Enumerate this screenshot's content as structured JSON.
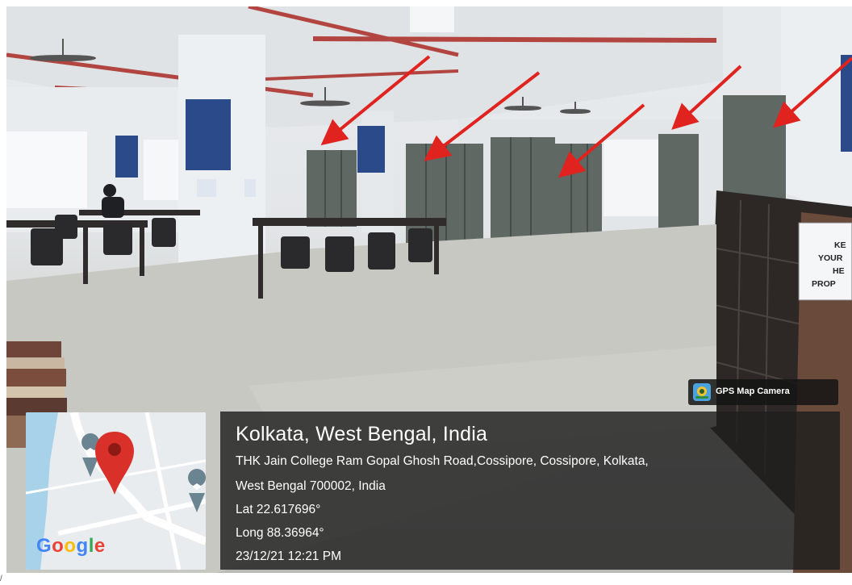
{
  "location": {
    "title": "Kolkata, West Bengal, India",
    "address_line1": "THK Jain College Ram Gopal Ghosh Road,Cossipore, Cossipore, Kolkata,",
    "address_line2": "West Bengal 700002, India",
    "latitude": "Lat 22.617696°",
    "longitude": "Long 88.36964°",
    "timestamp": "23/12/21 12:21 PM"
  },
  "map": {
    "provider_logo": "Google",
    "pin_icon": "map-pin-icon",
    "colors": {
      "pin": "#d9302a",
      "water": "#a8d2ea",
      "land": "#e8ecef",
      "road": "#ffffff",
      "poi": "#6a8591"
    }
  },
  "app_badge": {
    "label": "GPS Map Camera",
    "icon": "gps-camera-app-icon"
  },
  "wall_sign": {
    "lines": [
      "KE",
      "YOUR",
      "HE",
      "PROP"
    ]
  },
  "annotations": {
    "arrow_count": 5,
    "arrow_color": "#e0231f"
  },
  "edge_mark": "/"
}
